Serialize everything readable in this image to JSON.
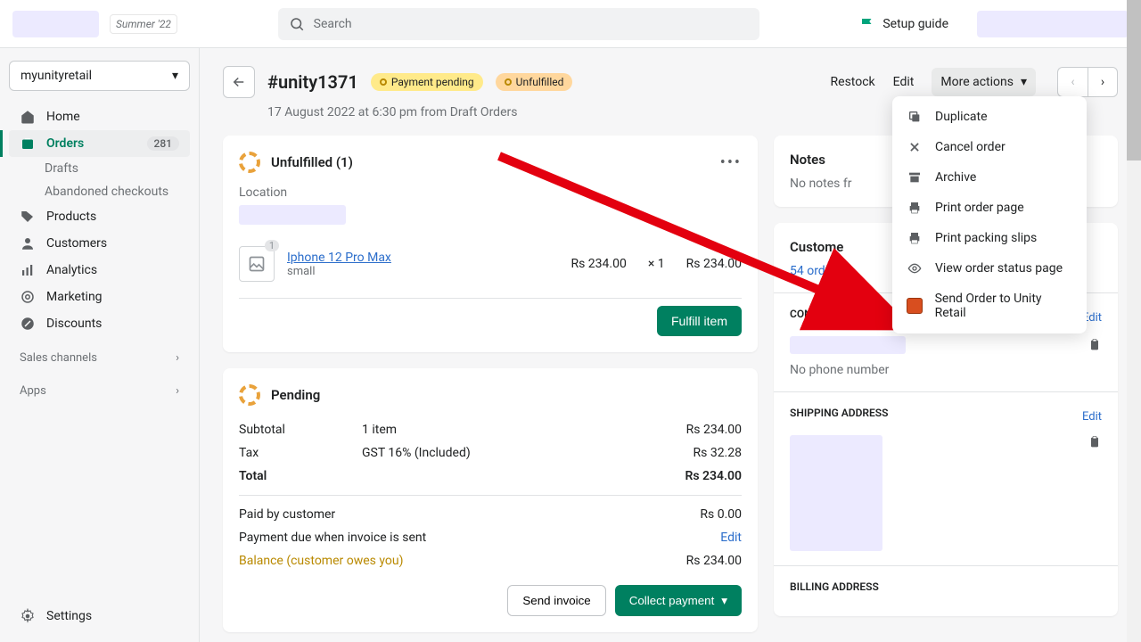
{
  "header": {
    "season_tag": "Summer '22",
    "search_placeholder": "Search",
    "setup_guide": "Setup guide"
  },
  "sidebar": {
    "store_name": "myunityretail",
    "nav": {
      "home": "Home",
      "orders": "Orders",
      "orders_badge": "281",
      "drafts": "Drafts",
      "abandoned": "Abandoned checkouts",
      "products": "Products",
      "customers": "Customers",
      "analytics": "Analytics",
      "marketing": "Marketing",
      "discounts": "Discounts"
    },
    "sales_channels": "Sales channels",
    "apps": "Apps",
    "settings": "Settings"
  },
  "page": {
    "order_id": "#unity1371",
    "chip_payment": "Payment pending",
    "chip_fulfill": "Unfulfilled",
    "restock": "Restock",
    "edit": "Edit",
    "more_actions": "More actions",
    "subheader": "17 August 2022 at 6:30 pm from Draft Orders"
  },
  "unfulfilled": {
    "title": "Unfulfilled (1)",
    "location_label": "Location",
    "item": {
      "qty_badge": "1",
      "name": "Iphone 12 Pro Max",
      "variant": "small",
      "unit_price": "Rs 234.00",
      "mult": "× 1",
      "total": "Rs 234.00"
    },
    "fulfill_btn": "Fulfill item"
  },
  "pending": {
    "title": "Pending",
    "subtotal_l": "Subtotal",
    "subtotal_m": "1 item",
    "subtotal_r": "Rs 234.00",
    "tax_l": "Tax",
    "tax_m": "GST 16% (Included)",
    "tax_r": "Rs 32.28",
    "total_l": "Total",
    "total_r": "Rs 234.00",
    "paid_l": "Paid by customer",
    "paid_r": "Rs 0.00",
    "due_l": "Payment due when invoice is sent",
    "due_edit": "Edit",
    "balance_l": "Balance (customer owes you)",
    "balance_r": "Rs 234.00",
    "send_invoice": "Send invoice",
    "collect_payment": "Collect payment"
  },
  "sidecol": {
    "notes_title": "Notes",
    "notes_empty": "No notes fr",
    "customer_title": "Custome",
    "customer_orders": "54 ord",
    "contact_label": "CONTACT INFORMATION",
    "edit": "Edit",
    "no_phone": "No phone number",
    "shipping_label": "SHIPPING ADDRESS",
    "billing_label": "BILLING ADDRESS"
  },
  "dropdown": {
    "duplicate": "Duplicate",
    "cancel": "Cancel order",
    "archive": "Archive",
    "print_order": "Print order page",
    "print_slip": "Print packing slips",
    "view_status": "View order status page",
    "send_unity": "Send Order to Unity Retail"
  }
}
